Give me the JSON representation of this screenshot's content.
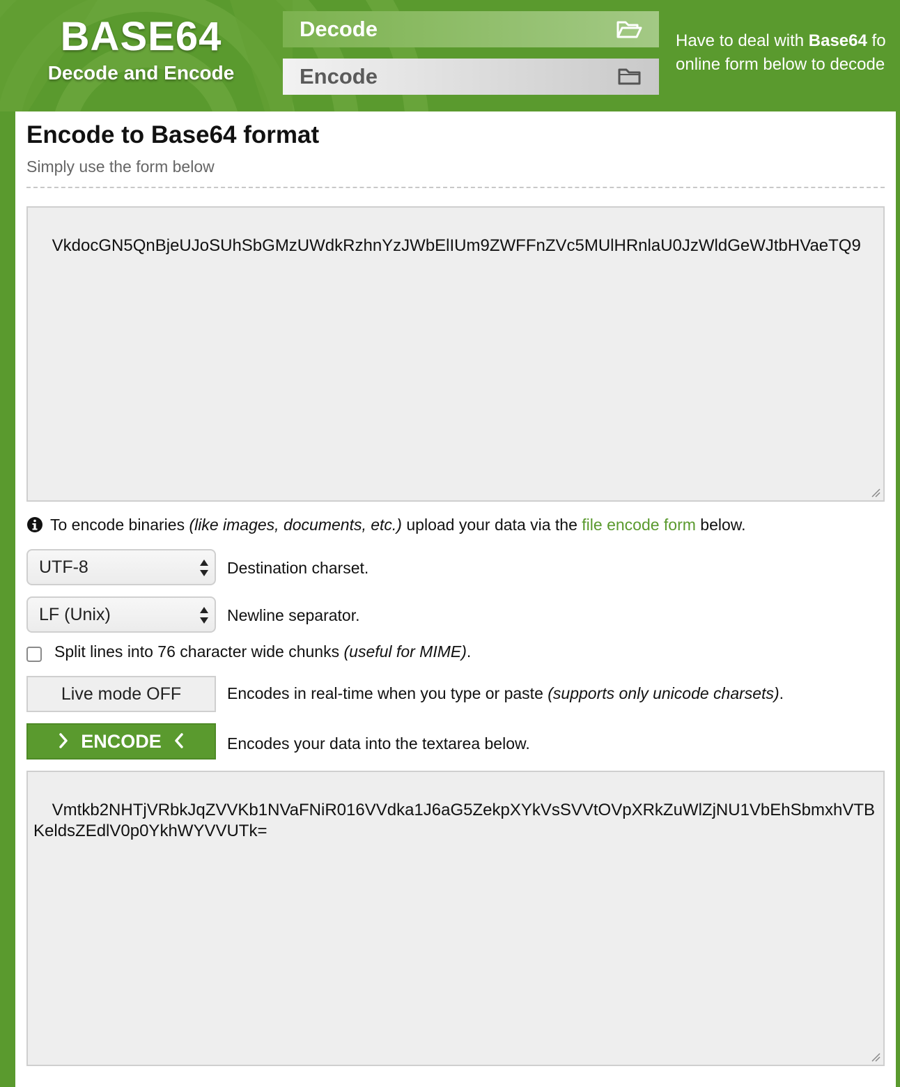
{
  "header": {
    "logo_title": "BASE64",
    "logo_subtitle": "Decode and Encode",
    "nav": {
      "decode_label": "Decode",
      "encode_label": "Encode"
    },
    "tagline": {
      "prefix": "Have to deal with ",
      "bold": "Base64",
      "suffix": " fo",
      "line2": "online form below to decode"
    }
  },
  "main": {
    "title": "Encode to Base64 format",
    "subtitle": "Simply use the form below",
    "input_text": "VkdocGN5QnBjeUJoSUhSbGMzUWdkRzhnYzJWbElIUm9ZWFFnZVc5MUlHRnlaU0JzWldGeWJtbHVaeTQ9",
    "info": {
      "text1": "To encode binaries ",
      "italic": "(like images, documents, etc.)",
      "text2": " upload your data via the ",
      "link": "file encode form",
      "text3": " below."
    },
    "charset": {
      "value": "UTF-8",
      "label": "Destination charset."
    },
    "newline": {
      "value": "LF (Unix)",
      "label": "Newline separator."
    },
    "split": {
      "checked": false,
      "text": "Split lines into 76 character wide chunks ",
      "italic": "(useful for MIME)",
      "suffix": "."
    },
    "live_mode": {
      "label": "Live mode OFF",
      "text": "Encodes in real-time when you type or paste ",
      "italic": "(supports only unicode charsets)",
      "suffix": "."
    },
    "encode": {
      "label": "ENCODE",
      "desc": "Encodes your data into the textarea below."
    },
    "output_text": "Vmtkb2NHTjVRbkJqZVVKb1NVaFNiR016VVdka1J6aG5ZekpXYkVsSVVtOVpXRkZuWlZjNU1VbEhSbmxhVTBKeldsZEdlV0p0YkhWYVVUTk="
  },
  "colors": {
    "brand_green": "#5a9a2e",
    "link_green": "#5a9a2e",
    "textarea_bg": "#eeeeee"
  },
  "icons": {
    "decode_nav": "folder-open-icon",
    "encode_nav": "folder-icon",
    "info": "info-circle-icon",
    "select_arrows": "up-down-arrows-icon",
    "encode_left": "chevron-right-icon",
    "encode_right": "chevron-left-icon"
  }
}
